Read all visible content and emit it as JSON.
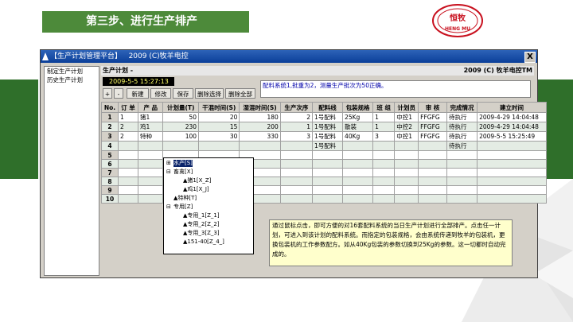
{
  "slide": {
    "title": "第三步、进行生产排产",
    "logo_top": "恒牧",
    "logo_bottom": "HENG MU"
  },
  "window": {
    "title": "【生产计划管理平台】   2009 (C)牧羊电控",
    "close_label": "X"
  },
  "sidebar": {
    "items": [
      {
        "label": "制定生产计划"
      },
      {
        "label": "历史生产计划"
      }
    ]
  },
  "plan": {
    "header_left": "生产计划 -",
    "header_right": "2009 (C) 牧羊电控TM",
    "datetime": "2009-5-5 15:27:13",
    "message": "配料系统1,批重为2，测量生产批次为50正确。"
  },
  "toolbar": {
    "plus": "+",
    "minus": "-",
    "new": "新建",
    "edit": "修改",
    "save": "保存",
    "delete_selected": "删除选择",
    "delete_all": "删除全部"
  },
  "table": {
    "columns": [
      "No.",
      "订 单",
      "产 品",
      "计划量(T)",
      "干混时间(S)",
      "湿混时间(S)",
      "生产次序",
      "配料线",
      "包装规格",
      "班 组",
      "计划员",
      "审 核",
      "完成情况",
      "建立时间"
    ],
    "rows": [
      [
        "1",
        "1",
        "猪1",
        "50",
        "20",
        "180",
        "2",
        "1号配料",
        "25Kg",
        "1",
        "中控1",
        "FFGFG",
        "待执行",
        "2009-4-29 14:04:48"
      ],
      [
        "2",
        "2",
        "鸡1",
        "230",
        "15",
        "200",
        "1",
        "1号配料",
        "散装",
        "1",
        "中控2",
        "FFGFG",
        "待执行",
        "2009-4-29 14:04:48"
      ],
      [
        "3",
        "2",
        "特种",
        "100",
        "30",
        "330",
        "3",
        "1号配料",
        "40Kg",
        "3",
        "中控1",
        "FFGFG",
        "待执行",
        "2009-5-5 15:25:49"
      ],
      [
        "4",
        "",
        "",
        "",
        "",
        "",
        "",
        "1号配料",
        "",
        "",
        "",
        "",
        "待执行",
        ""
      ],
      [
        "5",
        "",
        "",
        "",
        "",
        "",
        "",
        "",
        "",
        "",
        "",
        "",
        "",
        ""
      ],
      [
        "6",
        "",
        "",
        "",
        "",
        "",
        "",
        "",
        "",
        "",
        "",
        "",
        "",
        ""
      ],
      [
        "7",
        "",
        "",
        "",
        "",
        "",
        "",
        "",
        "",
        "",
        "",
        "",
        "",
        ""
      ],
      [
        "8",
        "",
        "",
        "",
        "",
        "",
        "",
        "",
        "",
        "",
        "",
        "",
        "",
        ""
      ],
      [
        "9",
        "",
        "",
        "",
        "",
        "",
        "",
        "",
        "",
        "",
        "",
        "",
        "",
        ""
      ],
      [
        "10",
        "",
        "",
        "",
        "",
        "",
        "",
        "",
        "",
        "",
        "",
        "",
        "",
        ""
      ]
    ]
  },
  "product_tree": {
    "items": [
      {
        "label": "水产[S]"
      },
      {
        "label": "畜禽[X]"
      },
      {
        "label": "▲猪1[X_Z]"
      },
      {
        "label": "▲鸡1[X_J]"
      },
      {
        "label": "▲特种[T]"
      },
      {
        "label": "专用[Z]"
      },
      {
        "label": "▲专用_1[Z_1]"
      },
      {
        "label": "▲专用_2[Z_2]"
      },
      {
        "label": "▲专用_3[Z_3]"
      },
      {
        "label": "▲151-40[Z_4_]"
      }
    ]
  },
  "info_note": "通过鼠标点击，即可方便的对16套配料系统的当日生产计划进行全部排产。点击任一计划，可进入到该计划的配料系统。而指定的包装规格，会由系统传递到牧羊的包装机，更换包装机的工作参数配方。如从40Kg包装的参数切换到25Kg的参数。这一切都时自动完成的。",
  "colors": {
    "banner": "#4d8a3a",
    "band": "#2f6f2a",
    "logo_red": "#c8101e",
    "window_title": "#0b3f99"
  }
}
